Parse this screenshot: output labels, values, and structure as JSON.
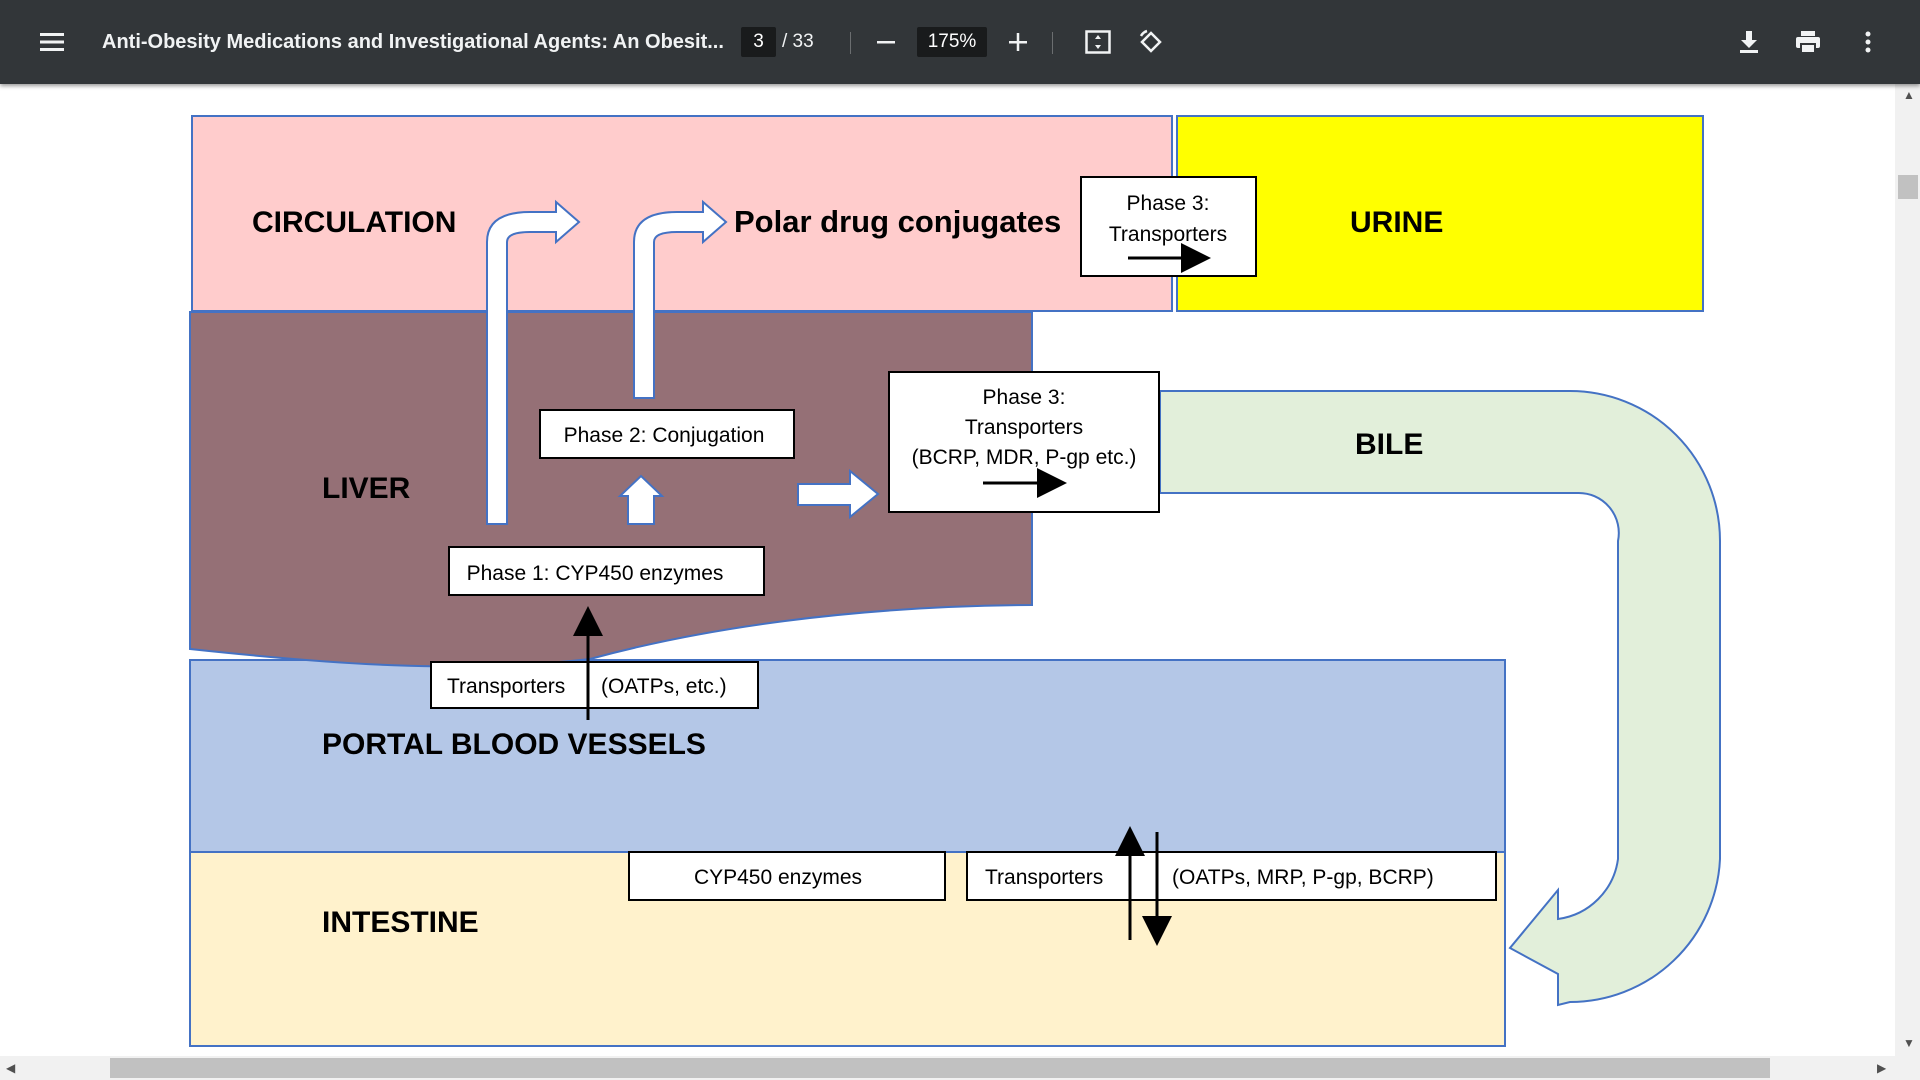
{
  "toolbar": {
    "title": "Anti-Obesity Medications and Investigational Agents: An Obesit...",
    "page_current": "3",
    "page_total": "/ 33",
    "zoom": "175%"
  },
  "diagram": {
    "circulation": "CIRCULATION",
    "polar": "Polar drug conjugates",
    "phase3_top_line1": "Phase 3:",
    "phase3_top_line2": "Transporters",
    "urine": "URINE",
    "liver": "LIVER",
    "phase2": "Phase 2: Conjugation",
    "phase3_mid_line1": "Phase 3:",
    "phase3_mid_line2": "Transporters",
    "phase3_mid_line3": "(BCRP, MDR, P-gp etc.)",
    "bile": "BILE",
    "phase1": "Phase 1: CYP450 enzymes",
    "transporters_portal": "Transporters",
    "oatps": "(OATPs, etc.)",
    "portal": "PORTAL BLOOD VESSELS",
    "cyp450": "CYP450 enzymes",
    "transporters_intestine": "Transporters",
    "oatps_mrp": "(OATPs, MRP, P-gp, BCRP)",
    "intestine": "INTESTINE"
  },
  "colors": {
    "circulation": "#ffcccc",
    "urine": "#ffff00",
    "liver": "#957076",
    "bile": "#e2efda",
    "portal": "#b4c7e7",
    "intestine": "#fff2cc",
    "border": "#4472c4"
  },
  "icons": [
    "menu-icon",
    "minus-icon",
    "plus-icon",
    "fit-page-icon",
    "rotate-icon",
    "download-icon",
    "print-icon",
    "more-icon"
  ]
}
